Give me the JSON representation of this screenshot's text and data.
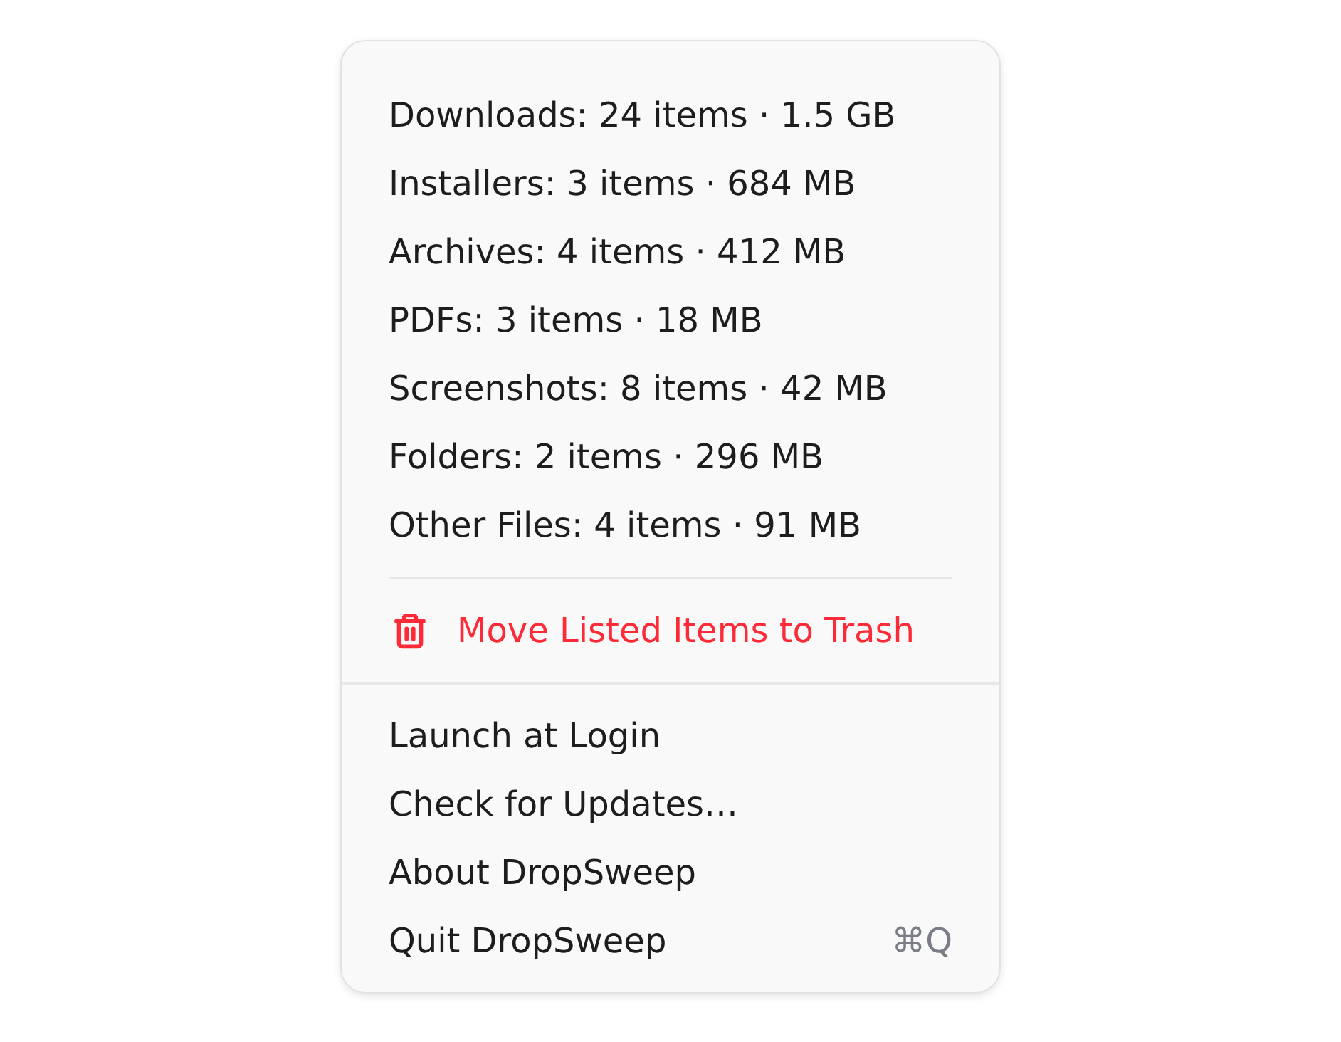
{
  "menu": {
    "stats": [
      "Downloads: 24 items · 1.5 GB",
      "Installers: 3 items · 684 MB",
      "Archives: 4 items · 412 MB",
      "PDFs: 3 items · 18 MB",
      "Screenshots: 8 items · 42 MB",
      "Folders: 2 items · 296 MB",
      "Other Files: 4 items · 91 MB"
    ],
    "trash_action": {
      "label": "Move Listed Items to Trash"
    },
    "items": [
      {
        "label": "Launch at Login"
      },
      {
        "label": "Check for Updates…"
      },
      {
        "label": "About DropSweep"
      },
      {
        "label": "Quit DropSweep",
        "shortcut": "⌘Q"
      }
    ]
  }
}
